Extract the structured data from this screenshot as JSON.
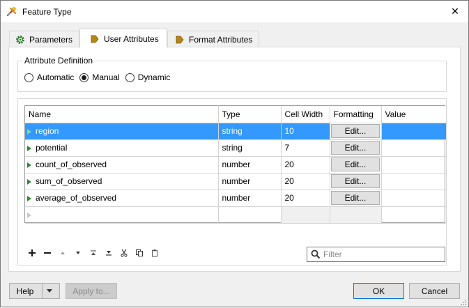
{
  "window": {
    "title": "Feature Type",
    "close_symbol": "✕"
  },
  "tabs": [
    {
      "label": "Parameters",
      "icon": "gear-icon",
      "active": false
    },
    {
      "label": "User Attributes",
      "icon": "tag-icon",
      "active": true
    },
    {
      "label": "Format Attributes",
      "icon": "tag-icon",
      "active": false
    }
  ],
  "attribute_definition": {
    "legend": "Attribute Definition",
    "options": [
      "Automatic",
      "Manual",
      "Dynamic"
    ],
    "selected": "Manual"
  },
  "grid": {
    "columns": [
      "Name",
      "Type",
      "Cell Width",
      "Formatting",
      "Value"
    ],
    "rows": [
      {
        "name": "region",
        "type": "string",
        "width": "10",
        "formatting": "Edit...",
        "value": "",
        "selected": true
      },
      {
        "name": "potential",
        "type": "string",
        "width": "7",
        "formatting": "Edit...",
        "value": "",
        "selected": false
      },
      {
        "name": "count_of_observed",
        "type": "number",
        "width": "20",
        "formatting": "Edit...",
        "value": "",
        "selected": false
      },
      {
        "name": "sum_of_observed",
        "type": "number",
        "width": "20",
        "formatting": "Edit...",
        "value": "",
        "selected": false
      },
      {
        "name": "average_of_observed",
        "type": "number",
        "width": "20",
        "formatting": "Edit...",
        "value": "",
        "selected": false
      }
    ]
  },
  "toolbar": [
    "add-icon",
    "remove-icon",
    "move-up-icon",
    "move-down-icon",
    "move-top-icon",
    "move-bottom-icon",
    "cut-icon",
    "copy-icon",
    "paste-icon"
  ],
  "filter": {
    "placeholder": "Filter"
  },
  "buttons": {
    "help": "Help",
    "apply": "Apply to...",
    "ok": "OK",
    "cancel": "Cancel"
  },
  "colors": {
    "selection": "#3399ff",
    "default_button_border": "#0078d7",
    "row_marker": "#2e8b2e"
  }
}
